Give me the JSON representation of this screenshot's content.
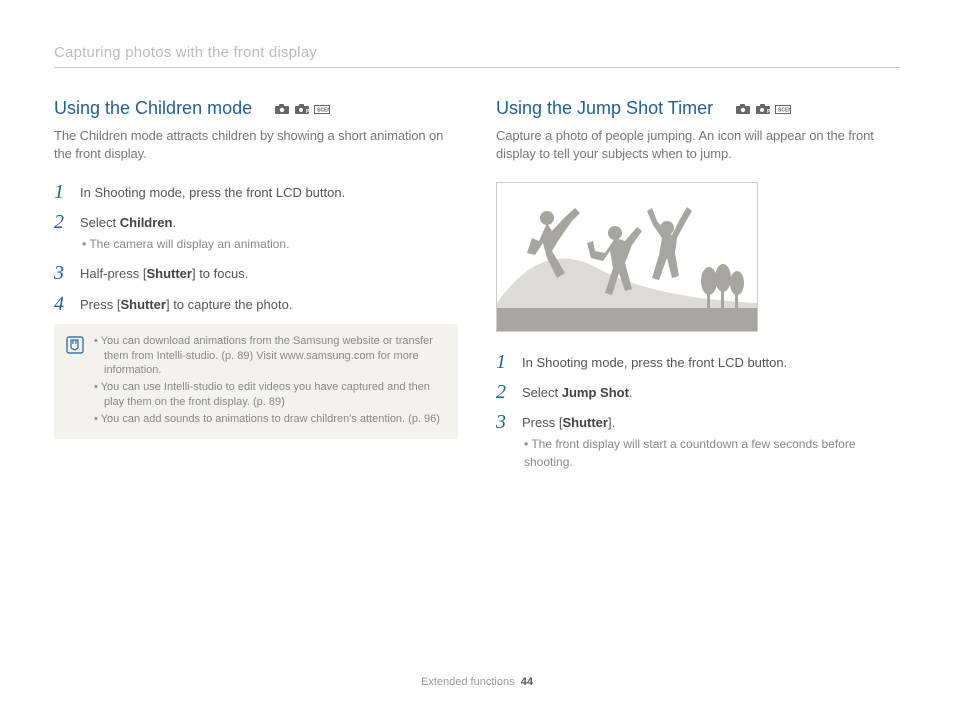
{
  "header": "Capturing photos with the front display",
  "left": {
    "title": "Using the Children mode",
    "intro": "The Children mode attracts children by showing a short animation on the front display.",
    "steps": [
      {
        "num": "1",
        "text": "In Shooting mode, press the front LCD button."
      },
      {
        "num": "2",
        "text_pre": "Select ",
        "text_bold": "Children",
        "text_post": ".",
        "sub": [
          "The camera will display an animation."
        ]
      },
      {
        "num": "3",
        "text_pre": "Half-press [",
        "text_bold": "Shutter",
        "text_post": "] to focus."
      },
      {
        "num": "4",
        "text_pre": "Press [",
        "text_bold": "Shutter",
        "text_post": "] to capture the photo."
      }
    ],
    "notes": [
      "You can download animations from the Samsung website or transfer them from Intelli-studio. (p. 89) Visit www.samsung.com for more information.",
      "You can use Intelli-studio to edit videos you have captured and then play them on the front display. (p. 89)",
      "You can add sounds to animations to draw children's attention. (p. 96)"
    ]
  },
  "right": {
    "title": "Using the Jump Shot Timer",
    "intro": "Capture a photo of people jumping. An icon will appear on the front display to tell your subjects when to jump.",
    "steps": [
      {
        "num": "1",
        "text": "In Shooting mode, press the front LCD button."
      },
      {
        "num": "2",
        "text_pre": "Select ",
        "text_bold": "Jump Shot",
        "text_post": "."
      },
      {
        "num": "3",
        "text_pre": "Press [",
        "text_bold": "Shutter",
        "text_post": "].",
        "sub": [
          "The front display will start a countdown a few seconds before shooting."
        ]
      }
    ]
  },
  "footer": {
    "section": "Extended functions",
    "page": "44"
  }
}
